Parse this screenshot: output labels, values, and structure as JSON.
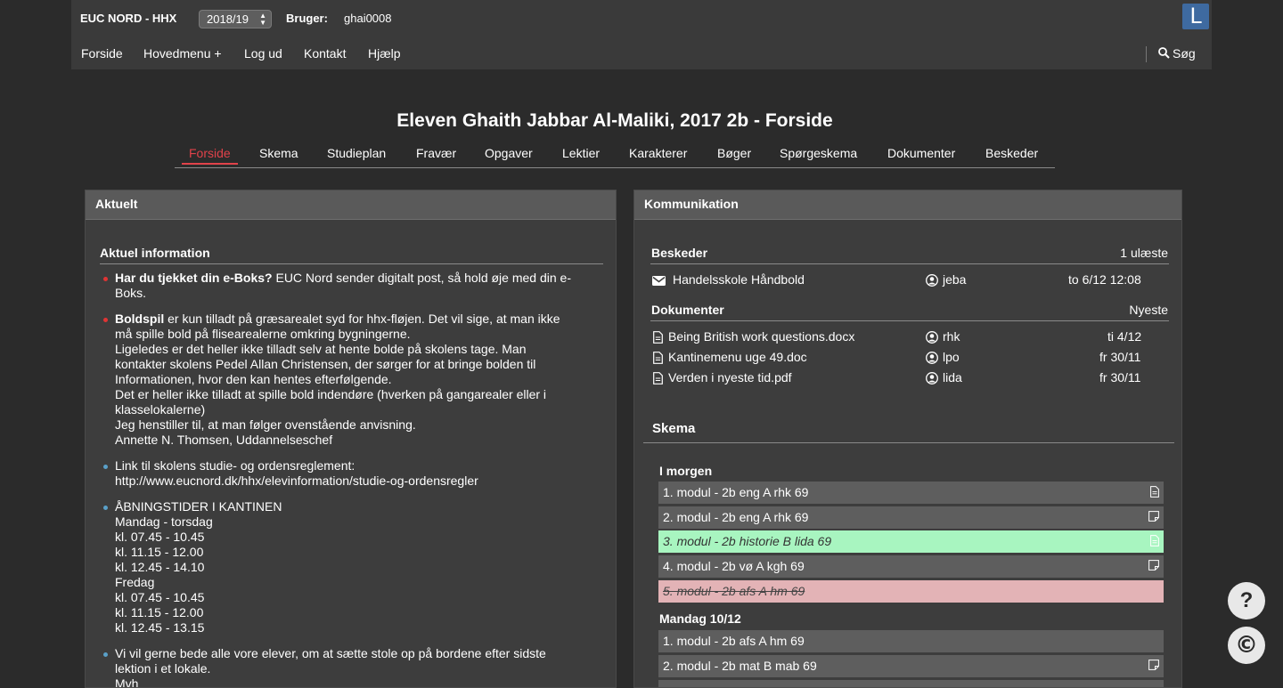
{
  "header": {
    "brand": "EUC NORD - HHX",
    "year": "2018/19",
    "user_label": "Bruger:",
    "user_name": "ghai0008",
    "logo_letter": "L",
    "nav": [
      "Forside",
      "Hovedmenu +",
      "Log ud",
      "Kontakt",
      "Hjælp"
    ],
    "search_label": "Søg"
  },
  "page": {
    "title": "Eleven Ghaith Jabbar Al-Maliki, 2017 2b - Forside",
    "tabs": [
      "Forside",
      "Skema",
      "Studieplan",
      "Fravær",
      "Opgaver",
      "Lektier",
      "Karakterer",
      "Bøger",
      "Spørgeskema",
      "Dokumenter",
      "Beskeder"
    ],
    "active_tab": "Forside",
    "accent_color": "#e0424a"
  },
  "aktuelt": {
    "panel_title": "Aktuelt",
    "section_title": "Aktuel information",
    "items": [
      {
        "bold": "Har du tjekket din e-Boks?",
        "lines": [
          " EUC Nord sender digitalt post, så hold øje med din e-",
          "Boks."
        ],
        "bullet": "red"
      },
      {
        "bold": "Boldspil",
        "lines": [
          " er kun tilladt på græsarealet syd for hhx-fløjen. Det vil sige, at man ikke",
          "må spille bold på fliseareal­erne omkring bygningerne.",
          "Ligeledes er det heller ikke tilladt selv at hente bolde på skolens tage. Man",
          "kontakter skolens Pedel Allan Christensen, der sørger for at bringe bolden til",
          "Informationen, hvor den kan hentes efterfølgende.",
          "Det er heller ikke tilladt at spille bold indendøre (hverken på gangarealer eller i",
          "klasselokalerne)",
          "Jeg henstiller til, at man følger ovenstående anvisning.",
          "Annette N. Thomsen, Uddannelseschef"
        ],
        "bullet": "red"
      },
      {
        "bold": "",
        "lines": [
          "Link til skolens studie- og ordensreglement:",
          "http://www.eucnord.dk/hhx/elevinformation/studie-og-ordensregler"
        ],
        "bullet": "blue"
      },
      {
        "bold": "",
        "lines": [
          "ÅBNINGSTIDER I KANTINEN",
          "Mandag - torsdag",
          "kl.  07.45 - 10.45",
          "kl. 11.15 - 12.00",
          "kl. 12.45 - 14.10",
          "Fredag",
          "kl. 07.45 - 10.45",
          "kl. 11.15 - 12.00",
          "kl. 12.45 - 13.15"
        ],
        "bullet": "blue"
      },
      {
        "bold": "",
        "lines": [
          "Vi vil gerne bede alle vore elever, om at sætte stole op på bordene efter sidste",
          "lektion i et lokale.",
          "Mvh"
        ],
        "bullet": "blue"
      }
    ]
  },
  "kommunikation": {
    "panel_title": "Kommunikation",
    "beskeder": {
      "title": "Beskeder",
      "status": "1 ulæste",
      "rows": [
        {
          "subject": "Handelsskole Håndbold",
          "user": "jeba",
          "date": "to 6/12 12:08"
        }
      ]
    },
    "dokumenter": {
      "title": "Dokumenter",
      "status": "Nyeste",
      "rows": [
        {
          "name": "Being British work questions.docx",
          "user": "rhk",
          "date": "ti 4/12"
        },
        {
          "name": "Kantinemenu uge 49.doc",
          "user": "lpo",
          "date": "fr 30/11"
        },
        {
          "name": "Verden i nyeste tid.pdf",
          "user": "lida",
          "date": "fr 30/11"
        }
      ]
    },
    "skema": {
      "title": "Skema",
      "days": [
        {
          "label": "I morgen",
          "rows": [
            {
              "text": "1. modul - 2b eng A  rhk  69",
              "state": "normal",
              "icon": "document-icon"
            },
            {
              "text": "2. modul - 2b eng A  rhk  69",
              "state": "normal",
              "icon": "note-icon"
            },
            {
              "text": "3. modul - 2b historie B  lida  69",
              "state": "changed",
              "icon": "document-icon"
            },
            {
              "text": "4. modul - 2b vø A  kgh  69",
              "state": "normal",
              "icon": "note-icon"
            },
            {
              "text": "5. modul - 2b afs A  hm  69",
              "state": "cancelled",
              "icon": ""
            }
          ]
        },
        {
          "label": "Mandag 10/12",
          "rows": [
            {
              "text": "1. modul - 2b afs A  hm  69",
              "state": "normal",
              "icon": ""
            },
            {
              "text": "2. modul - 2b mat B  mab  69",
              "state": "normal",
              "icon": "note-icon"
            }
          ]
        }
      ],
      "colors": {
        "changed": "#a8f5c0",
        "cancelled": "#e3b3b6",
        "normal": "#5e5e5e"
      }
    }
  },
  "fabs": {
    "help": "?",
    "copyright": "©"
  }
}
